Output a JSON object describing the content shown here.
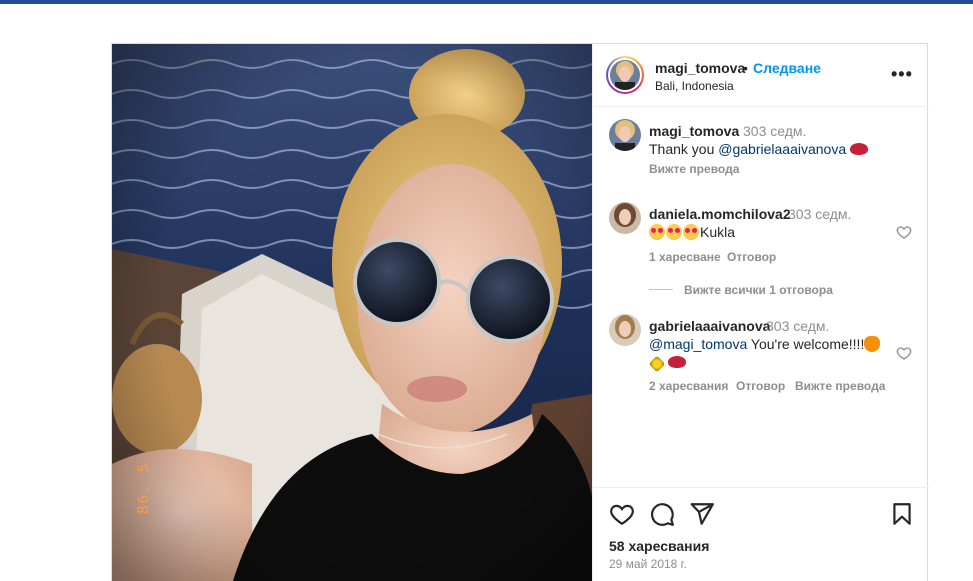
{
  "post": {
    "author": {
      "username": "magi_tomova",
      "follow_label": "Следване",
      "location": "Bali, Indonesia",
      "separator": "•",
      "more_label": "•••"
    },
    "caption": {
      "username": "magi_tomova",
      "time": "303 седм.",
      "text_prefix": "Thank you ",
      "mention": "@gabrielaaaivanova",
      "translate_label": "Вижте превода"
    },
    "comments": [
      {
        "username": "daniela.momchilova2",
        "time": "303 седм.",
        "text": "Kukla",
        "likes_label": "1 харесване",
        "reply_label": "Отговор",
        "view_replies_label": "Вижте всички 1 отговора"
      },
      {
        "username": "gabrielaaaivanova",
        "time": "303 седм.",
        "mention": "@magi_tomova",
        "text": " You're welcome!!!!",
        "likes_label": "2 харесвания",
        "reply_label": "Отговор",
        "translate_label": "Вижте превода"
      }
    ],
    "likes_count": "58 харесвания",
    "date": "29 май 2018 г.",
    "photo_stamp": "86. 5"
  },
  "colors": {
    "accent": "#0095f6",
    "topbar": "#1f4e96",
    "muted": "#8e8e8e",
    "mention": "#00376b"
  },
  "icons": [
    "heart-icon",
    "comment-icon",
    "share-icon",
    "bookmark-icon",
    "more-icon"
  ]
}
